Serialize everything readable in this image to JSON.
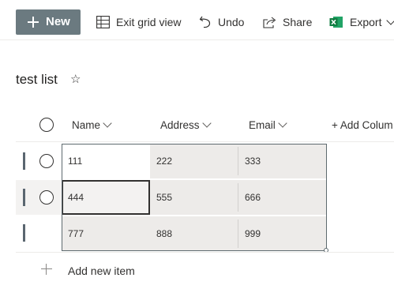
{
  "toolbar": {
    "new_label": "New",
    "exit_grid_label": "Exit grid view",
    "undo_label": "Undo",
    "share_label": "Share",
    "export_label": "Export",
    "export_icon_color": "#1d6f42",
    "new_button_color": "#6b7a80"
  },
  "list": {
    "title": "test list",
    "favorite_icon": "star-outline-icon"
  },
  "grid": {
    "columns": [
      {
        "label": "Name"
      },
      {
        "label": "Address"
      },
      {
        "label": "Email"
      }
    ],
    "add_column_label": "+ Add Colum",
    "rows": [
      {
        "name": "111",
        "address": "222",
        "email": "333"
      },
      {
        "name": "444",
        "address": "555",
        "email": "666"
      },
      {
        "name": "777",
        "address": "888",
        "email": "999"
      }
    ],
    "add_item_label": "Add new item"
  }
}
